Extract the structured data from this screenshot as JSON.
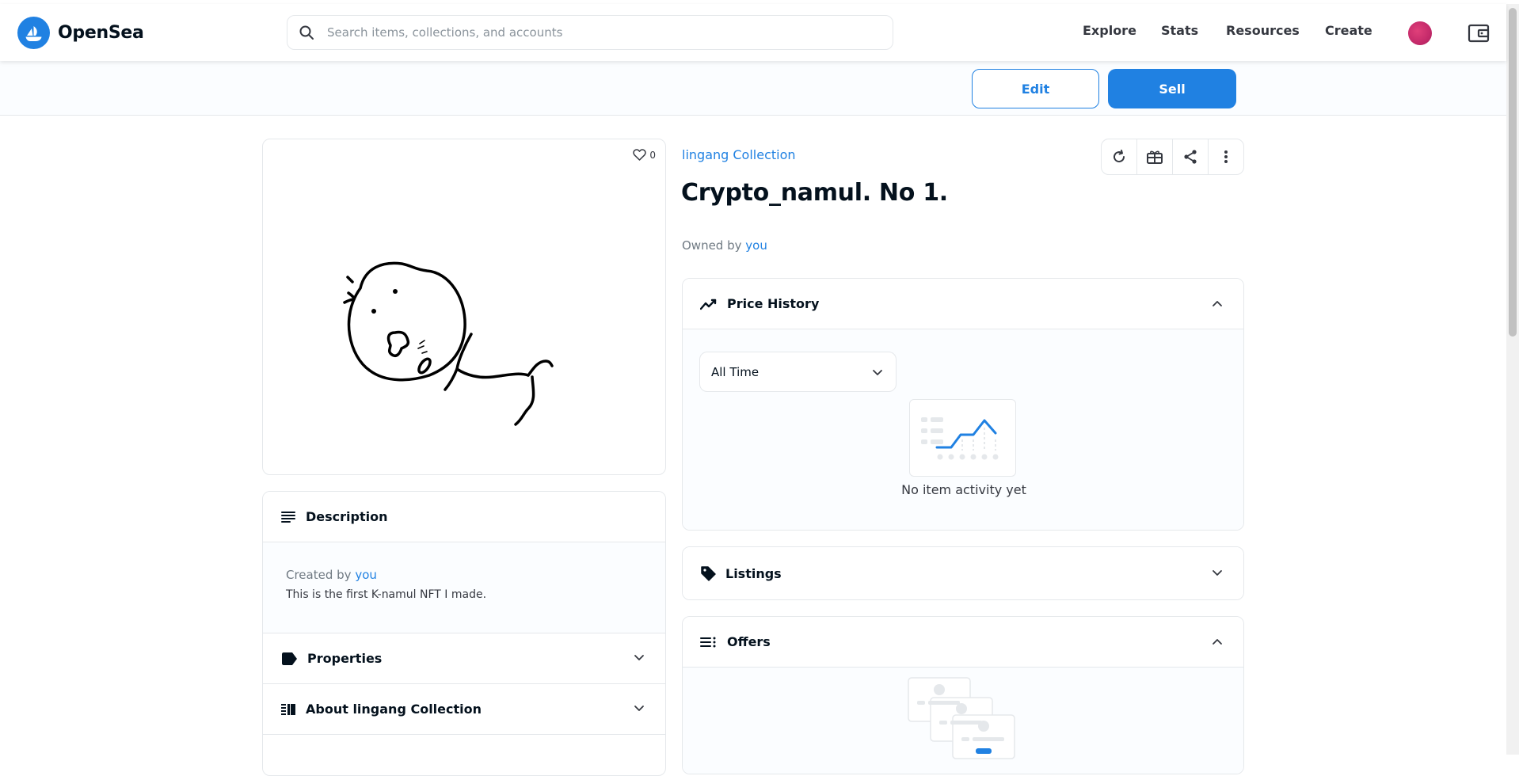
{
  "header": {
    "logo_text": "OpenSea",
    "search_placeholder": "Search items, collections, and accounts",
    "nav": [
      {
        "label": "Explore"
      },
      {
        "label": "Stats"
      },
      {
        "label": "Resources"
      },
      {
        "label": "Create"
      }
    ]
  },
  "actions": {
    "edit_label": "Edit",
    "sell_label": "Sell"
  },
  "item": {
    "likes": "0",
    "collection": "lingang Collection",
    "title": "Crypto_namul. No 1.",
    "owned_by_prefix": "Owned by",
    "owner": "you"
  },
  "left_panels": {
    "description_title": "Description",
    "created_by_prefix": "Created by",
    "creator": "you",
    "description_text": "This is the first K-namul NFT I made.",
    "properties_title": "Properties",
    "about_title": "About lingang Collection"
  },
  "price_history": {
    "title": "Price History",
    "period_selected": "All Time",
    "empty_text": "No item activity yet"
  },
  "listings": {
    "title": "Listings"
  },
  "offers": {
    "title": "Offers"
  },
  "colors": {
    "accent": "#2081e2",
    "text": "#04111d",
    "muted": "#707a83"
  }
}
